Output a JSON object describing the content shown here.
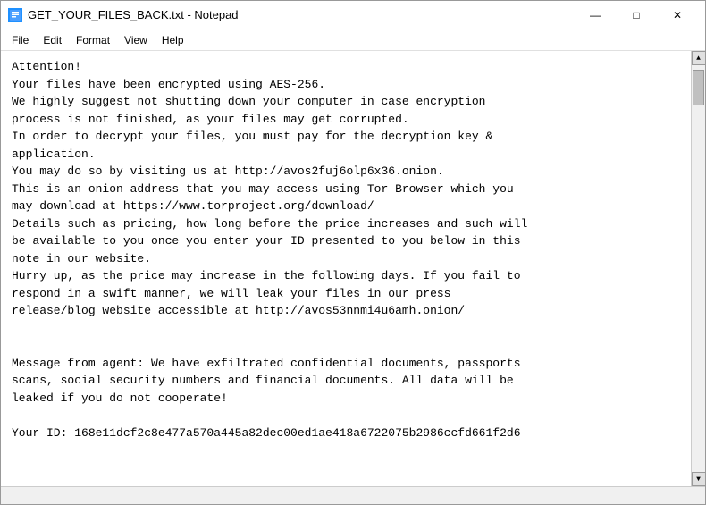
{
  "window": {
    "title": "GET_YOUR_FILES_BACK.txt - Notepad",
    "icon_label": "N"
  },
  "title_controls": {
    "minimize": "—",
    "maximize": "□",
    "close": "✕"
  },
  "menu": {
    "items": [
      "File",
      "Edit",
      "Format",
      "View",
      "Help"
    ]
  },
  "content": {
    "text": "Attention!\nYour files have been encrypted using AES-256.\nWe highly suggest not shutting down your computer in case encryption\nprocess is not finished, as your files may get corrupted.\nIn order to decrypt your files, you must pay for the decryption key &\napplication.\nYou may do so by visiting us at http://avos2fuj6olp6x36.onion.\nThis is an onion address that you may access using Tor Browser which you\nmay download at https://www.torproject.org/download/\nDetails such as pricing, how long before the price increases and such will\nbe available to you once you enter your ID presented to you below in this\nnote in our website.\nHurry up, as the price may increase in the following days. If you fail to\nrespond in a swift manner, we will leak your files in our press\nrelease/blog website accessible at http://avos53nnmi4u6amh.onion/\n\n\nMessage from agent: We have exfiltrated confidential documents, passports\nscans, social security numbers and financial documents. All data will be\nleaked if you do not cooperate!\n\nYour ID: 168e11dcf2c8e477a570a445a82dec00ed1ae418a6722075b2986ccfd661f2d6"
  }
}
